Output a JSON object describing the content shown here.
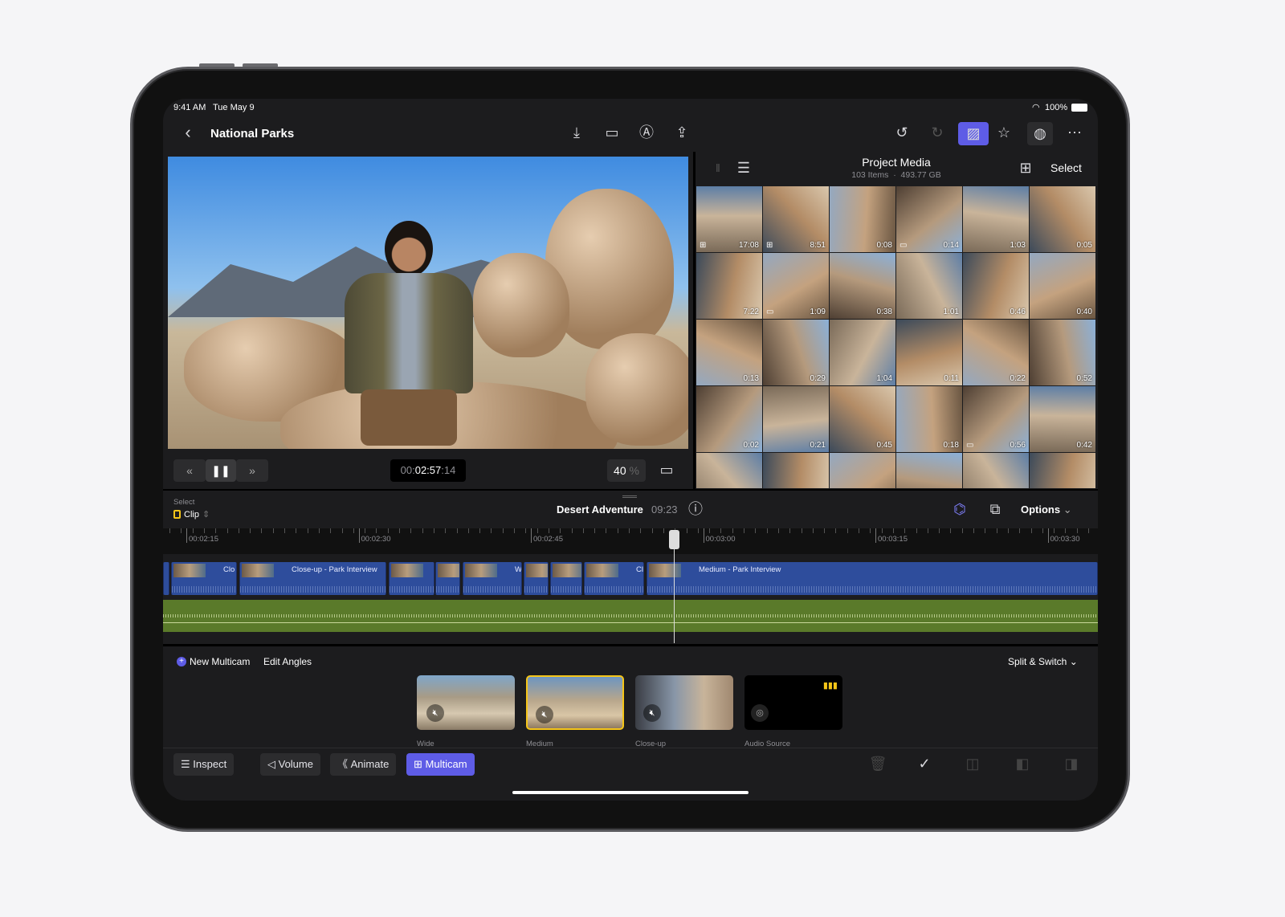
{
  "status_bar": {
    "time": "9:41 AM",
    "date": "Tue May 9",
    "battery": "100%"
  },
  "header": {
    "title": "National Parks",
    "icons": [
      "import-icon",
      "camera-icon",
      "voiceover-icon",
      "share-icon",
      "undo-icon",
      "redo-icon",
      "photos-icon",
      "stickers-icon",
      "enhance-icon",
      "more-icon"
    ]
  },
  "viewer": {
    "timecode_dim": "00:",
    "timecode": "02:57",
    "timecode_frames": ":14",
    "zoom": "40",
    "zoom_unit": "%"
  },
  "media": {
    "title": "Project Media",
    "subtitle": "103 Items  ·  493.77 GB",
    "select": "Select",
    "durations": [
      "17:08",
      "8:51",
      "0:08",
      "0:14",
      "1:03",
      "0:05",
      "7:22",
      "1:09",
      "0:38",
      "1:01",
      "0:46",
      "0:40",
      "0:13",
      "0:29",
      "1:04",
      "0:11",
      "0:22",
      "0:52",
      "0:02",
      "0:21",
      "0:45",
      "0:18",
      "0:56",
      "0:42",
      "",
      "",
      "",
      "",
      "",
      ""
    ]
  },
  "timeline": {
    "select_label": "Select",
    "select_value": "Clip",
    "project": "Desert Adventure",
    "duration": "09:23",
    "options": "Options",
    "ruler": [
      "00:02:15",
      "00:02:30",
      "00:02:45",
      "00:03:00",
      "00:03:15",
      "00:03:30"
    ],
    "clips": [
      "Clo",
      "Close-up - Park Interview",
      "",
      "",
      "W",
      "",
      "",
      "Cl",
      "Medium - Park Interview"
    ]
  },
  "multicam": {
    "new": "New Multicam",
    "edit": "Edit Angles",
    "mode": "Split & Switch",
    "angles": [
      "Wide",
      "Medium",
      "Close-up",
      "Audio Source"
    ],
    "active_angle": "Medium"
  },
  "toolbar": {
    "inspect": "Inspect",
    "volume": "Volume",
    "animate": "Animate",
    "multicam": "Multicam"
  },
  "colors": {
    "accent": "#5e5ce6",
    "selection": "#f5c518",
    "clip": "#2e4d9c",
    "audio": "#5a7a2a"
  }
}
